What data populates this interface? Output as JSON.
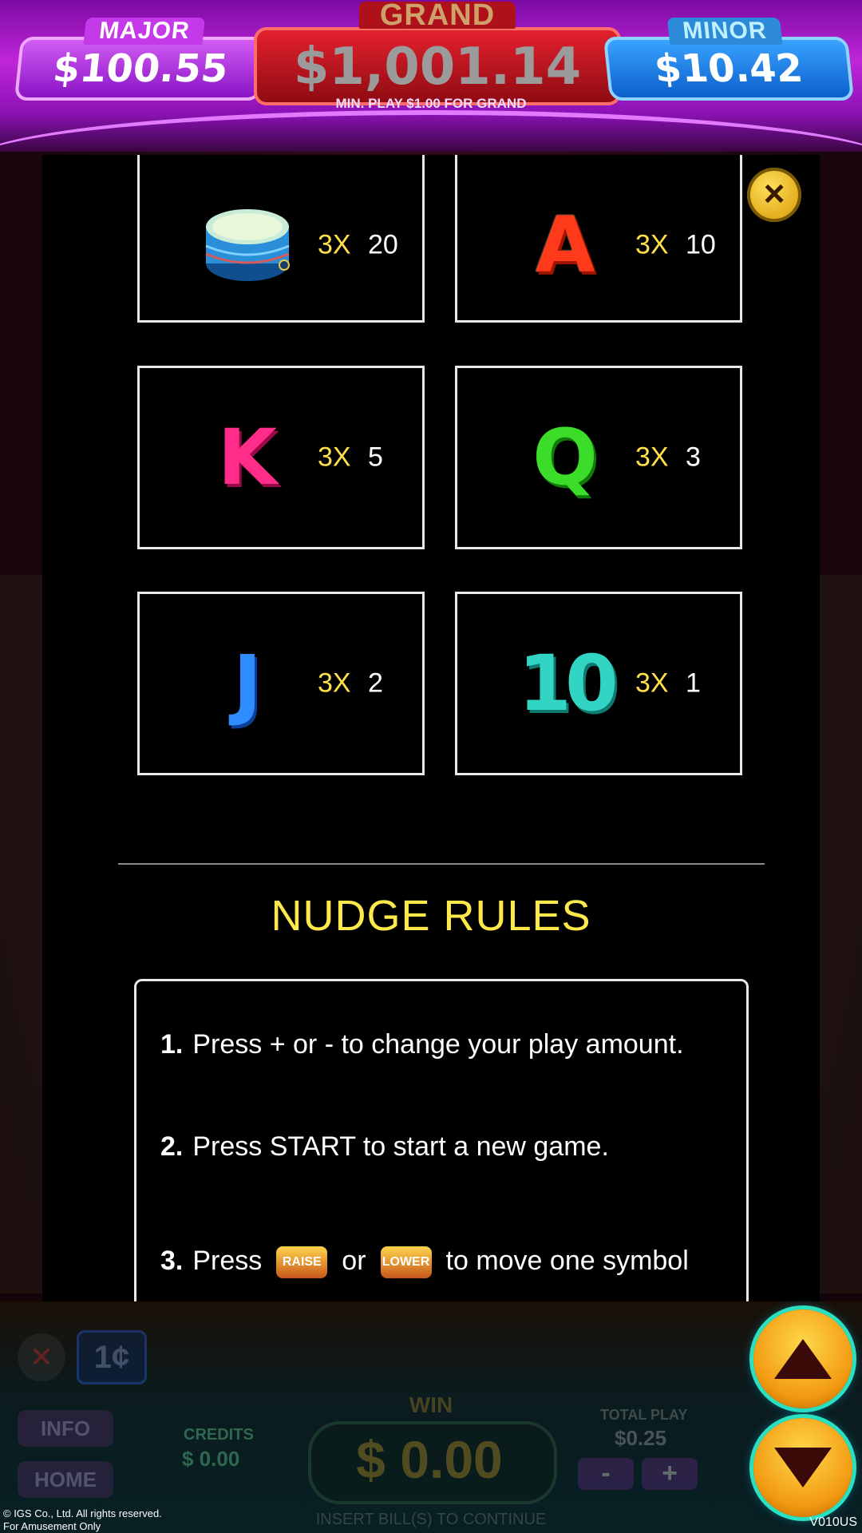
{
  "jackpots": {
    "major": {
      "label": "MAJOR",
      "value": "$100.55"
    },
    "grand": {
      "label": "GRAND",
      "value": "$1,001.14",
      "note": "MIN. PLAY $1.00 FOR GRAND"
    },
    "minor": {
      "label": "MINOR",
      "value": "$10.42"
    }
  },
  "paytable": [
    {
      "symbol": "drum",
      "multiplier": "3X",
      "payout": "20"
    },
    {
      "symbol": "A",
      "multiplier": "3X",
      "payout": "10"
    },
    {
      "symbol": "K",
      "multiplier": "3X",
      "payout": "5"
    },
    {
      "symbol": "Q",
      "multiplier": "3X",
      "payout": "3"
    },
    {
      "symbol": "J",
      "multiplier": "3X",
      "payout": "2"
    },
    {
      "symbol": "10",
      "multiplier": "3X",
      "payout": "1"
    }
  ],
  "nudge": {
    "title": "NUDGE RULES",
    "rules": [
      {
        "num": "1.",
        "text": "Press + or - to change your play amount."
      },
      {
        "num": "2.",
        "text": "Press START to start a new game."
      },
      {
        "num": "3.",
        "pre": "Press",
        "mid": "or",
        "post": "to move one symbol",
        "raise_badge": "RAISE",
        "lower_badge": "LOWER"
      }
    ]
  },
  "controls": {
    "denom": "1¢",
    "info": "INFO",
    "home": "HOME",
    "credits_label": "CREDITS",
    "credits_value": "$ 0.00",
    "win_label": "WIN",
    "win_value": "$ 0.00",
    "total_play_label": "TOTAL PLAY",
    "total_play_value": "$0.25",
    "minus": "-",
    "plus": "+",
    "insert_note": "INSERT BILL(S) TO CONTINUE"
  },
  "footer": {
    "copyright_line1": "© IGS Co., Ltd. All rights reserved.",
    "copyright_line2": "For Amusement Only",
    "version": "V010US"
  },
  "colors": {
    "multiplier": "#ffdf4a",
    "title": "#ffe84a",
    "accent_cyan": "#29e0c0"
  }
}
